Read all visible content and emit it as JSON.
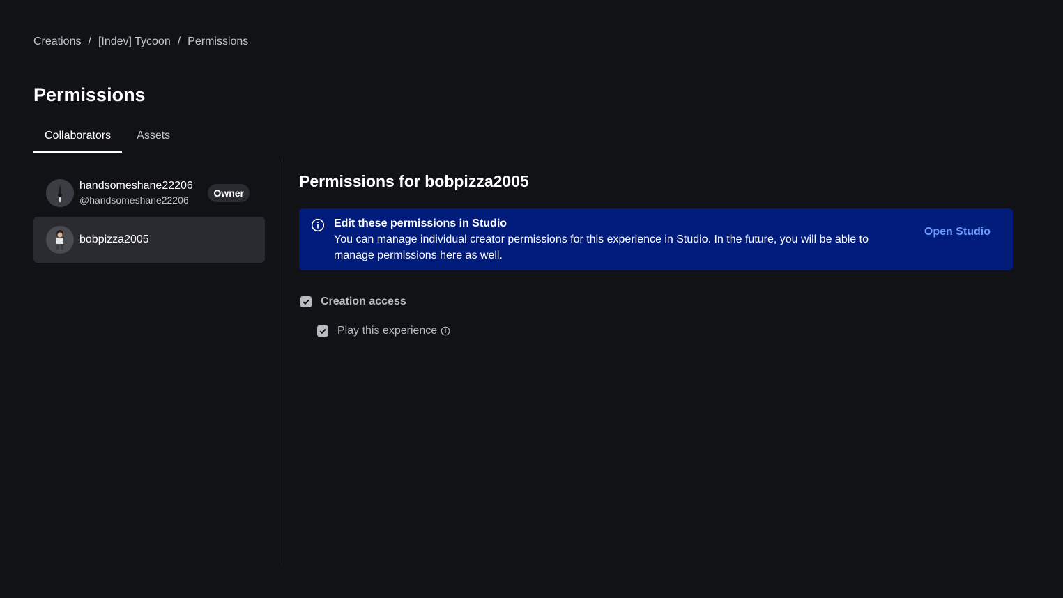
{
  "breadcrumb": {
    "items": [
      "Creations",
      "[Indev] Tycoon",
      "Permissions"
    ],
    "separator": "/"
  },
  "page": {
    "title": "Permissions"
  },
  "tabs": [
    {
      "label": "Collaborators",
      "active": true
    },
    {
      "label": "Assets",
      "active": false
    }
  ],
  "collaborators": [
    {
      "name": "handsomeshane22206",
      "handle": "@handsomeshane22206",
      "badge": "Owner",
      "selected": false
    },
    {
      "name": "bobpizza2005",
      "selected": true
    }
  ],
  "main": {
    "title": "Permissions for bobpizza2005",
    "banner": {
      "icon": "info-icon",
      "title": "Edit these permissions in Studio",
      "body": "You can manage individual creator permissions for this experience in Studio. In the future, you will be able to manage permissions here as well.",
      "action_label": "Open Studio"
    },
    "permissions": [
      {
        "label": "Creation access",
        "checked": true
      },
      {
        "label": "Play this experience",
        "checked": true,
        "help_icon": "info-icon"
      }
    ]
  },
  "colors": {
    "background": "#111216",
    "banner": "#011c7a",
    "link": "#6b9bff",
    "selected_row": "#2a2b30"
  }
}
